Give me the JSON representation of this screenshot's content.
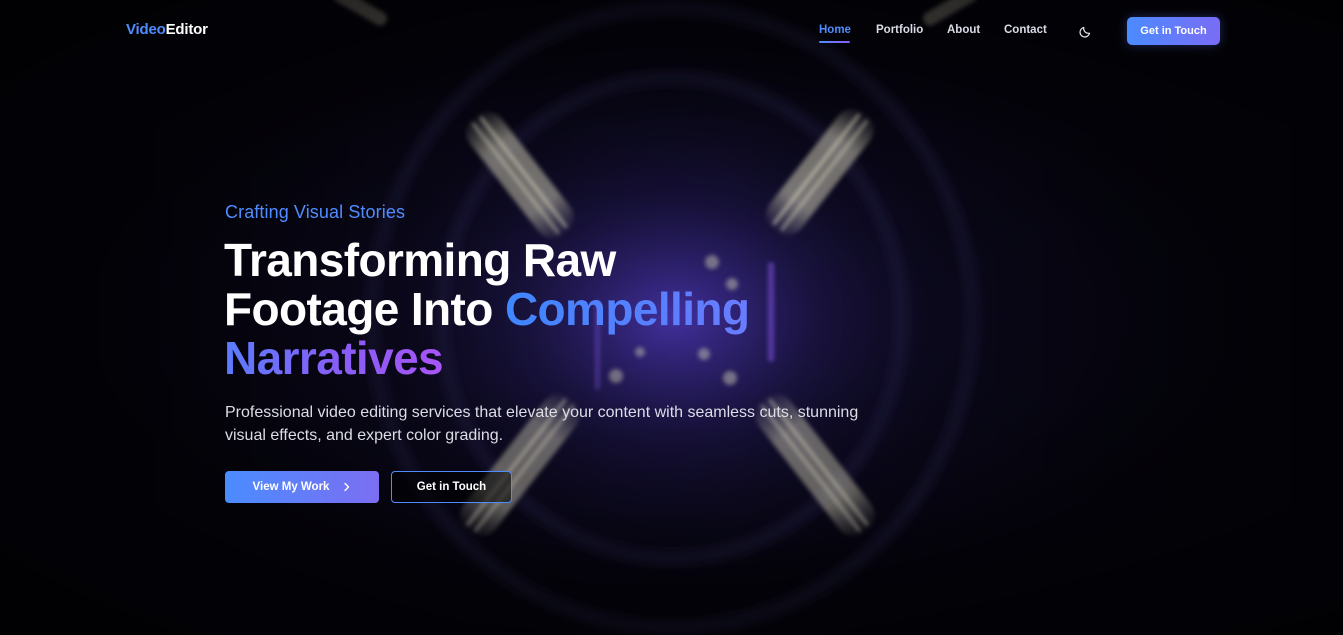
{
  "header": {
    "logo": {
      "part1": "Video",
      "part2": "Editor"
    },
    "nav": [
      {
        "label": "Home",
        "active": true
      },
      {
        "label": "Portfolio",
        "active": false
      },
      {
        "label": "About",
        "active": false
      },
      {
        "label": "Contact",
        "active": false
      }
    ],
    "theme_toggle_icon": "moon-icon",
    "cta_label": "Get in Touch"
  },
  "hero": {
    "eyebrow": "Crafting Visual Stories",
    "headline": {
      "line1": "Transforming Raw",
      "line2_plain": "Footage Into ",
      "line2_highlight": "Compelling",
      "line3_highlight": "Narratives"
    },
    "subtext": "Professional video editing services that elevate your content with seamless cuts, stunning visual effects, and expert color grading.",
    "primary_button": {
      "label": "View My Work",
      "icon": "chevron-right-icon"
    },
    "secondary_button": {
      "label": "Get in Touch"
    }
  },
  "colors": {
    "accent_blue": "#4f8dff",
    "accent_purple": "#a855f7",
    "background": "#05040c"
  }
}
